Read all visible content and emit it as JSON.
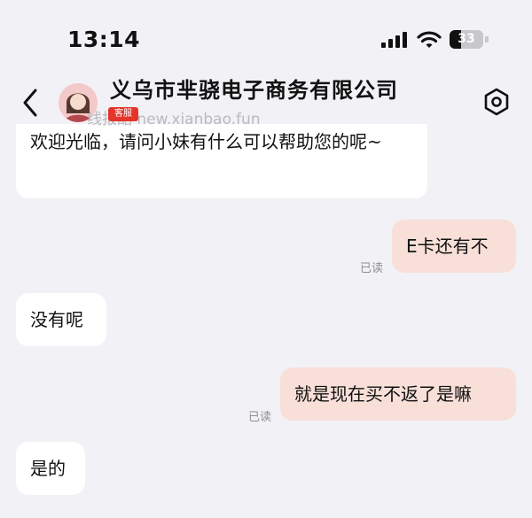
{
  "status_bar": {
    "time": "13:14",
    "battery": "33",
    "icons": [
      "cellular-signal-icon",
      "wifi-icon",
      "battery-icon"
    ]
  },
  "header": {
    "title": "义乌市芈骁电子商务有限公司",
    "watermark": "线报酷 new.xianbao.fun",
    "avatar_badge": "客服",
    "icons": [
      "back-chevron-icon",
      "settings-hexagon-icon"
    ]
  },
  "messages": [
    {
      "side": "in",
      "text": "欢迎光临，请问小妹有什么可以帮助您的呢~"
    },
    {
      "side": "out",
      "text": "E卡还有不",
      "status": "已读"
    },
    {
      "side": "in",
      "text": "没有呢"
    },
    {
      "side": "out",
      "text": "就是现在买不返了是嘛",
      "status": "已读"
    },
    {
      "side": "in",
      "text": "是的"
    }
  ],
  "colors": {
    "background": "#f2f2f6",
    "incoming_bubble": "#ffffff",
    "outgoing_bubble": "#f8dfd8",
    "read_status": "#8e8e93",
    "badge": "#e5352b"
  }
}
